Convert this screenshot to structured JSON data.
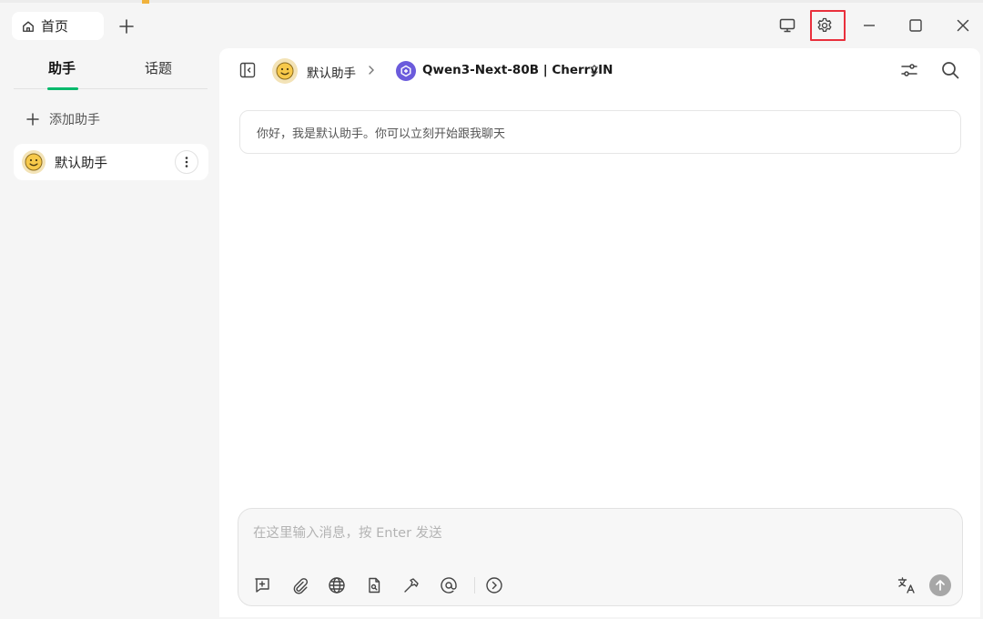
{
  "tabs": {
    "home_label": "首页"
  },
  "sidebar": {
    "tabs": [
      {
        "label": "助手",
        "active": true
      },
      {
        "label": "话题",
        "active": false
      }
    ],
    "add_assistant_label": "添加助手",
    "assistants": [
      {
        "name": "默认助手",
        "icon": "smiley-emoji"
      }
    ]
  },
  "header": {
    "assistant_name": "默认助手",
    "model_name": "Qwen3-Next-80B | CherryIN"
  },
  "chat": {
    "welcome_message": "你好，我是默认助手。你可以立刻开始跟我聊天"
  },
  "composer": {
    "placeholder": "在这里输入消息，按 Enter 发送",
    "value": ""
  },
  "colors": {
    "accent": "#00b96b",
    "highlight": "#e9303c",
    "model_icon": "#6b5bdc"
  }
}
